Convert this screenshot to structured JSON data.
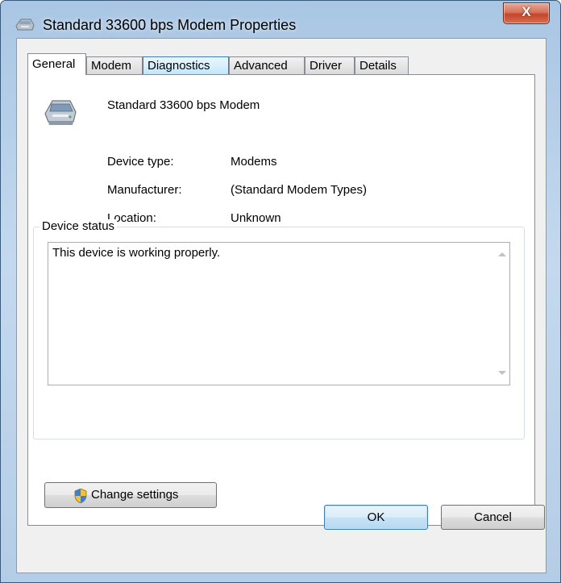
{
  "window": {
    "title": "Standard 33600 bps Modem Properties",
    "close_label": "X"
  },
  "tabs": [
    {
      "label": "General",
      "active": true
    },
    {
      "label": "Modem"
    },
    {
      "label": "Diagnostics"
    },
    {
      "label": "Advanced"
    },
    {
      "label": "Driver"
    },
    {
      "label": "Details"
    }
  ],
  "general": {
    "device_name": "Standard 33600 bps Modem",
    "device_type_label": "Device type:",
    "device_type_value": "Modems",
    "manufacturer_label": "Manufacturer:",
    "manufacturer_value": "(Standard Modem Types)",
    "location_label": "Location:",
    "location_value": "Unknown",
    "status_group_label": "Device status",
    "status_text": "This device is working properly.",
    "change_settings_label": "Change settings"
  },
  "buttons": {
    "ok": "OK",
    "cancel": "Cancel"
  },
  "icons": {
    "title": "modem-icon",
    "device": "modem-icon",
    "change_settings": "uac-shield-icon"
  }
}
